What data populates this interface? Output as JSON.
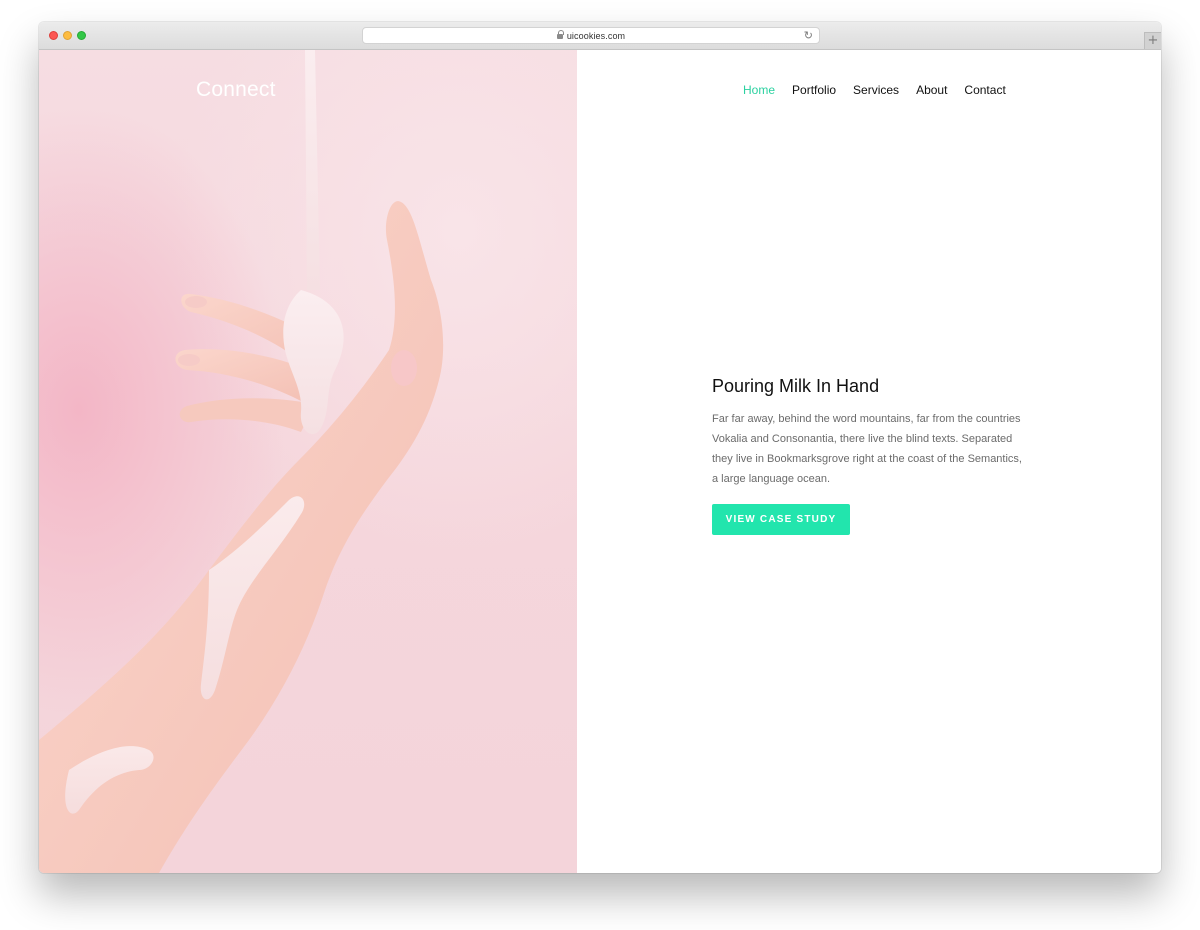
{
  "browser": {
    "url": "uicookies.com",
    "reload_icon": "reload-icon",
    "newtab_label": "+"
  },
  "brand": {
    "logo_text": "Connect"
  },
  "nav": {
    "items": [
      {
        "label": "Home",
        "active": true
      },
      {
        "label": "Portfolio",
        "active": false
      },
      {
        "label": "Services",
        "active": false
      },
      {
        "label": "About",
        "active": false
      },
      {
        "label": "Contact",
        "active": false
      }
    ]
  },
  "feature": {
    "title": "Pouring Milk In Hand",
    "description": "Far far away, behind the word mountains, far from the countries Vokalia and Consonantia, there live the blind texts. Separated they live in Bookmarksgrove right at the coast of the Semantics, a large language ocean.",
    "cta_label": "VIEW CASE STUDY"
  },
  "colors": {
    "accent": "#22e5ad",
    "nav_active": "#2bd1a0",
    "hero_background": "#f5d6dc"
  }
}
